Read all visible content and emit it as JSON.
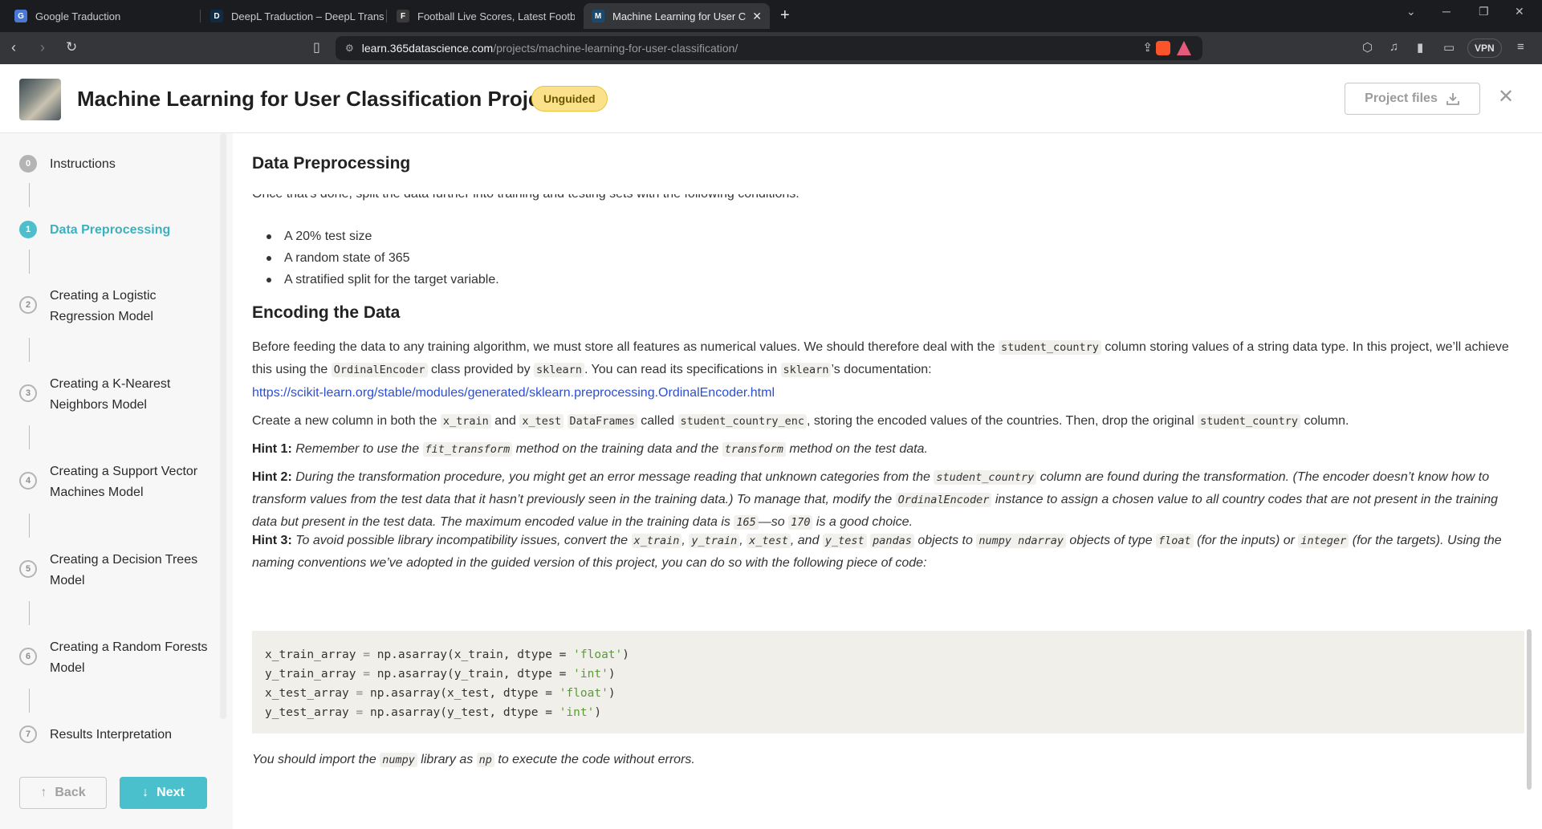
{
  "browser": {
    "tabs": [
      {
        "title": "Google Traduction",
        "fav": "G",
        "color": "#4a78d6"
      },
      {
        "title": "DeepL Traduction – DeepL Translate",
        "fav": "D",
        "color": "#0f2b46"
      },
      {
        "title": "Football Live Scores, Latest Football",
        "fav": "F",
        "color": "#3a3a3a"
      },
      {
        "title": "Machine Learning for User Class",
        "fav": "M",
        "color": "#1a4b6e"
      }
    ],
    "close_tab": "✕",
    "new_tab": "+",
    "url_host": "learn.365datascience.com",
    "url_path": "/projects/machine-learning-for-user-classification/",
    "vpn": "VPN"
  },
  "header": {
    "title": "Machine Learning for User Classification Project",
    "badge": "Unguided",
    "project_files": "Project files",
    "close": "✕"
  },
  "sidebar": {
    "steps": [
      {
        "num": "0",
        "label": "Instructions"
      },
      {
        "num": "1",
        "label": "Data Preprocessing"
      },
      {
        "num": "2",
        "label": "Creating a Logistic Regression Model"
      },
      {
        "num": "3",
        "label": "Creating a K-Nearest Neighbors Model"
      },
      {
        "num": "4",
        "label": "Creating a Support Vector Machines Model"
      },
      {
        "num": "5",
        "label": "Creating a Decision Trees Model"
      },
      {
        "num": "6",
        "label": "Creating a Random Forests Model"
      },
      {
        "num": "7",
        "label": "Results Interpretation"
      }
    ],
    "back": "Back",
    "next": "Next"
  },
  "content": {
    "section_title": "Data Preprocessing",
    "clipped_line": "Once that's done, split the data further into training and testing sets with the following conditions:",
    "bullets": [
      "A 20% test size",
      "A random state of 365",
      "A stratified split for the target variable."
    ],
    "encoding_title": "Encoding the Data",
    "p1": {
      "a": "Before feeding the data to any training algorithm, we must store all features as numerical values. We should therefore deal with the ",
      "c1": "student_country",
      "b": " column storing values of a string data type. In this project, we’ll achieve this using the ",
      "c2": "OrdinalEncoder",
      "c": " class provided by ",
      "c3": "sklearn",
      "d": ". You can read its specifications in ",
      "c4": "sklearn",
      "e": "’s documentation:"
    },
    "link": "https://scikit-learn.org/stable/modules/generated/sklearn.preprocessing.OrdinalEncoder.html",
    "p2": {
      "a": "Create a new column in both the ",
      "c1": "x_train",
      "b": " and ",
      "c2": "x_test",
      "c3": "DataFrames",
      "c": " called ",
      "c4": "student_country_enc",
      "d": ", storing the encoded values of the countries. Then, drop the original ",
      "c5": "student_country",
      "e": " column."
    },
    "hint1": {
      "label": "Hint 1:",
      "a": "Remember to use the ",
      "c1": "fit_transform",
      "b": " method on the training data and the ",
      "c2": "transform",
      "c": " method on the test data."
    },
    "hint2": {
      "label": "Hint 2:",
      "a": "During the transformation procedure, you might get an error message reading that unknown categories from the ",
      "c1": "student_country",
      "b": " column are found during the transformation. (The encoder doesn’t know how to transform values from the test data that it hasn’t previously seen in the training data.) To manage that, modify the ",
      "c2": "OrdinalEncoder",
      "c": " instance to assign a chosen value to all country codes that are not present in the training data but present in the test data. The maximum encoded value in the training data is ",
      "c3": "165",
      "d": "—so ",
      "c4": "170",
      "e": " is a good choice."
    },
    "hint3": {
      "label": "Hint 3:",
      "a": "To avoid possible library incompatibility issues, convert the ",
      "c1": "x_train",
      "s1": ", ",
      "c2": "y_train",
      "s2": ", ",
      "c3": "x_test",
      "s3": ", and ",
      "c4": "y_test",
      "c5": "pandas",
      "b": " objects to ",
      "c6": "numpy ndarray",
      "c": " objects of type ",
      "c7": "float",
      "d": " (for the inputs) or ",
      "c8": "integer",
      "e": " (for the targets). Using the naming conventions we’ve adopted in the guided version of this project, you can do so with the following piece of code:"
    },
    "code": [
      {
        "var": "x_train_array",
        "arg": "x_train",
        "dtype": "'float'"
      },
      {
        "var": "y_train_array",
        "arg": "y_train",
        "dtype": "'int'"
      },
      {
        "var": "x_test_array",
        "arg": "x_test",
        "dtype": "'float'"
      },
      {
        "var": "y_test_array",
        "arg": "y_test",
        "dtype": "'int'"
      }
    ],
    "code_eq": "=",
    "code_fn": "np.asarray(",
    "code_dtype": ", dtype =",
    "code_close": ")",
    "footer": {
      "a": "You should import the ",
      "c1": "numpy",
      "b": " library as ",
      "c2": "np",
      "c": " to execute the code without errors."
    }
  }
}
